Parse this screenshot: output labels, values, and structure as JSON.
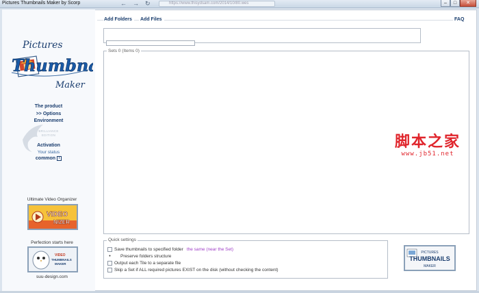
{
  "window": {
    "title": "Pictures Thumbnails Maker by Scorp",
    "address": "https://www.thisydsam.com/2014/10/80.wes",
    "minimize": "–",
    "maximize": "□",
    "close": "✕"
  },
  "logo": {
    "line1": "Pictures",
    "line2": "Thumbnails",
    "line3": "Maker"
  },
  "sidebar": {
    "product": "The product",
    "options": ">> Options",
    "environment": "Environment",
    "faded1": "BRILLIANCE",
    "faded2": "EDITION",
    "activation": "Activation",
    "your_status": "Your status",
    "common": "common",
    "help_glyph": "i"
  },
  "promos": {
    "video_label": "Ultimate Video Organizer",
    "video_badge_line1": "VIDEO",
    "video_badge_line2": "NIZER",
    "perfection_label": "Perfection starts here",
    "perfection_badge_line1": "VIDEO",
    "perfection_badge_line2": "THUMBNAILS",
    "perfection_badge_line3": "MAKER",
    "site": "suu-design.com"
  },
  "toolbar": {
    "add_folders": "Add Folders",
    "add_files": "Add Files",
    "faq": "FAQ"
  },
  "sets": {
    "label": "Sets 0 (Items 0)"
  },
  "quick_settings": {
    "label": "Quick settings",
    "save_to_folder": "Save thumbnails to specified folder",
    "same_near_set": "the same (near the Set)",
    "preserve_structure": "Preserve folders structure",
    "output_each_tile": "Output each Tile to a separate file",
    "skip_set": "Skip a Set if ALL required pictures EXIST on the disk (without checking the content)"
  },
  "badge": {
    "line1": "PICTURES",
    "line2": "THUMBNAILS",
    "line3": "MAKER"
  },
  "watermark": {
    "chars": "脚本之家",
    "url": "www.jb51.net"
  },
  "colors": {
    "nav_text": "#1a3d6e",
    "link_purple": "#a040c8",
    "watermark_red": "#e0252c"
  }
}
